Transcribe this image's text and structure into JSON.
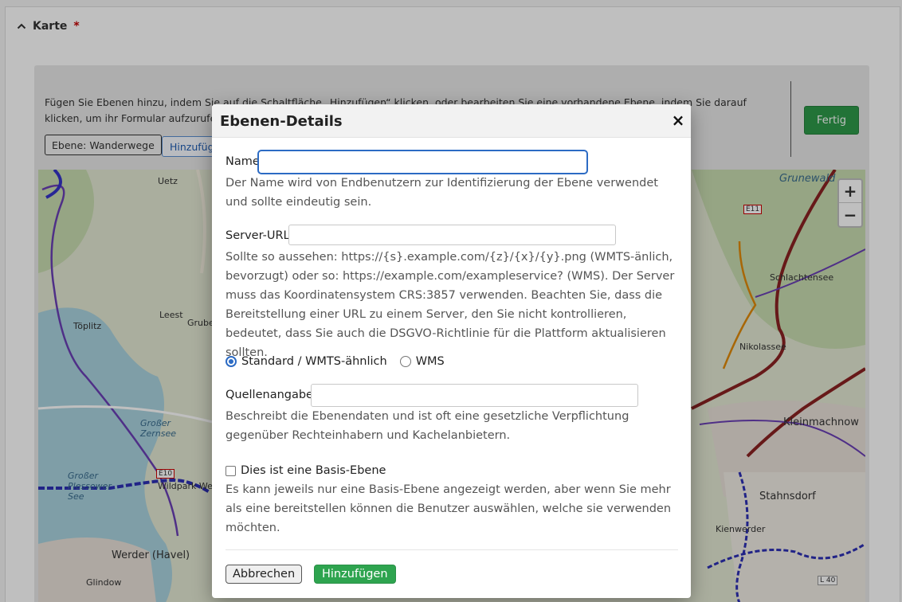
{
  "section": {
    "title": "Karte",
    "required_mark": "*"
  },
  "editor": {
    "help_text": "Fügen Sie Ebenen hinzu, indem Sie auf die Schaltfläche „Hinzufügen“ klicken, oder bearbeiten Sie eine vorhandene Ebene, indem Sie darauf klicken, um ihr Formular aufzurufen.",
    "layer_chip": "Ebene: Wanderwege",
    "add_button": "Hinzufügen",
    "done_button": "Fertig"
  },
  "map": {
    "zoom_in": "+",
    "zoom_out": "−",
    "labels": [
      "Grunewald",
      "Uetz",
      "Töplitz",
      "Leest",
      "Grube",
      "Schlachtensee",
      "Nikolassee",
      "Kleinmachnow",
      "Stahnsdorf",
      "Kienwerder",
      "Werder (Havel)",
      "Glindow",
      "Großer Zernsee",
      "Großer Plessower See",
      "Wildpark West",
      "E10",
      "E11",
      "L 40"
    ]
  },
  "modal": {
    "title": "Ebenen-Details",
    "close": "×",
    "name_label": "Name",
    "name_value": "",
    "name_hint": "Der Name wird von Endbenutzern zur Identifizierung der Ebene verwendet und sollte eindeutig sein.",
    "url_label": "Server-URL",
    "url_value": "",
    "url_hint": "Sollte so aussehen: https://{s}.example.com/{z}/{x}/{y}.png (WMTS-änlich, bevorzugt) oder so: https://example.com/exampleservice? (WMS). Der Server muss das Koordinatensystem CRS:3857 verwenden. Beachten Sie, dass die Bereitstellung einer URL zu einem Server, den Sie nicht kontrollieren, bedeutet, dass Sie auch die DSGVO-Richtlinie für die Plattform aktualisieren sollten.",
    "radio_standard": "Standard / WMTS-ähnlich",
    "radio_wms": "WMS",
    "selected_type": "standard",
    "source_label": "Quellenangabe",
    "source_value": "",
    "source_hint": "Beschreibt die Ebenendaten und ist oft eine gesetzliche Verpflichtung gegenüber Rechteinhabern und Kachelanbietern.",
    "base_label": "Dies ist eine Basis-Ebene",
    "base_checked": false,
    "base_hint": "Es kann jeweils nur eine Basis-Ebene angezeigt werden, aber wenn Sie mehr als eine bereitstellen können die Benutzer auswählen, welche sie verwenden möchten.",
    "cancel_button": "Abbrechen",
    "submit_button": "Hinzufügen"
  },
  "colors": {
    "accent": "#2c6bc4",
    "success": "#2ea44f"
  }
}
